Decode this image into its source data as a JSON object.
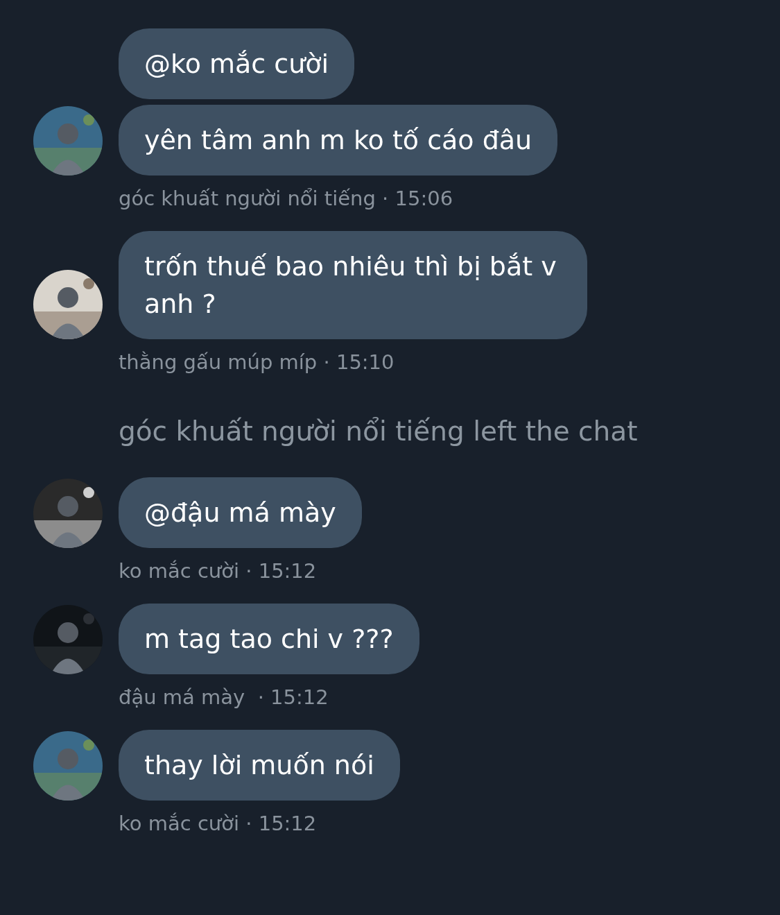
{
  "items": [
    {
      "kind": "group",
      "avatar": {
        "kind": "picture"
      },
      "messages": [
        "@ko mắc cười",
        "yên tâm anh m ko tố cáo đâu"
      ],
      "meta": "góc khuất người nổi tiếng · 15:06"
    },
    {
      "kind": "group",
      "avatar": {
        "kind": "picture"
      },
      "messages": [
        "trốn thuế bao nhiêu thì bị bắt v anh ?"
      ],
      "meta": "thằng gấu múp míp · 15:10"
    },
    {
      "kind": "system",
      "text": "góc khuất người nổi tiếng left the chat"
    },
    {
      "kind": "group",
      "avatar": {
        "kind": "picture"
      },
      "messages": [
        "@đậu má mày"
      ],
      "meta": "ko mắc cười · 15:12"
    },
    {
      "kind": "group",
      "avatar": {
        "kind": "picture"
      },
      "messages": [
        "m tag tao chi v ???"
      ],
      "meta": "đậu má mày  · 15:12"
    },
    {
      "kind": "group",
      "avatar": {
        "kind": "picture"
      },
      "messages": [
        "thay lời muốn nói"
      ],
      "meta": "ko mắc cười · 15:12"
    }
  ]
}
